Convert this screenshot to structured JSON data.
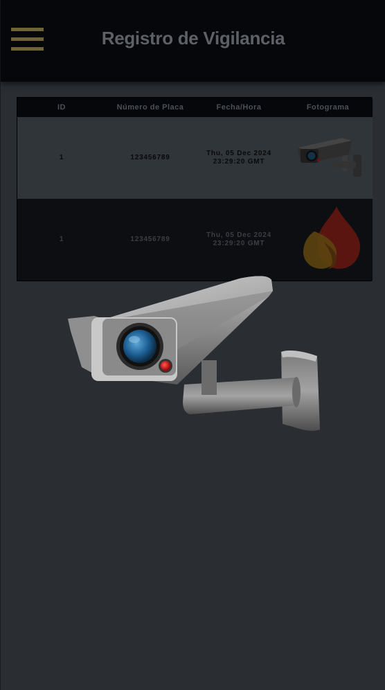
{
  "header": {
    "menu_icon": "hamburger-menu-icon",
    "title": "Registro de Vigilancia",
    "accent_color": "#6e6438"
  },
  "table": {
    "columns": [
      "ID",
      "Número de Placa",
      "Fecha/Hora",
      "Fotograma"
    ],
    "rows": [
      {
        "id": "1",
        "plate": "123456789",
        "datetime_line1": "Thu, 05 Dec 2024",
        "datetime_line2": "23:29:20 GMT",
        "frame_icon": "security-camera-icon"
      },
      {
        "id": "1",
        "plate": "123456789",
        "datetime_line1": "Thu, 05 Dec 2024",
        "datetime_line2": "23:29:20 GMT",
        "frame_icon": "fire-icon"
      }
    ]
  },
  "overlay": {
    "icon": "security-camera-icon"
  }
}
